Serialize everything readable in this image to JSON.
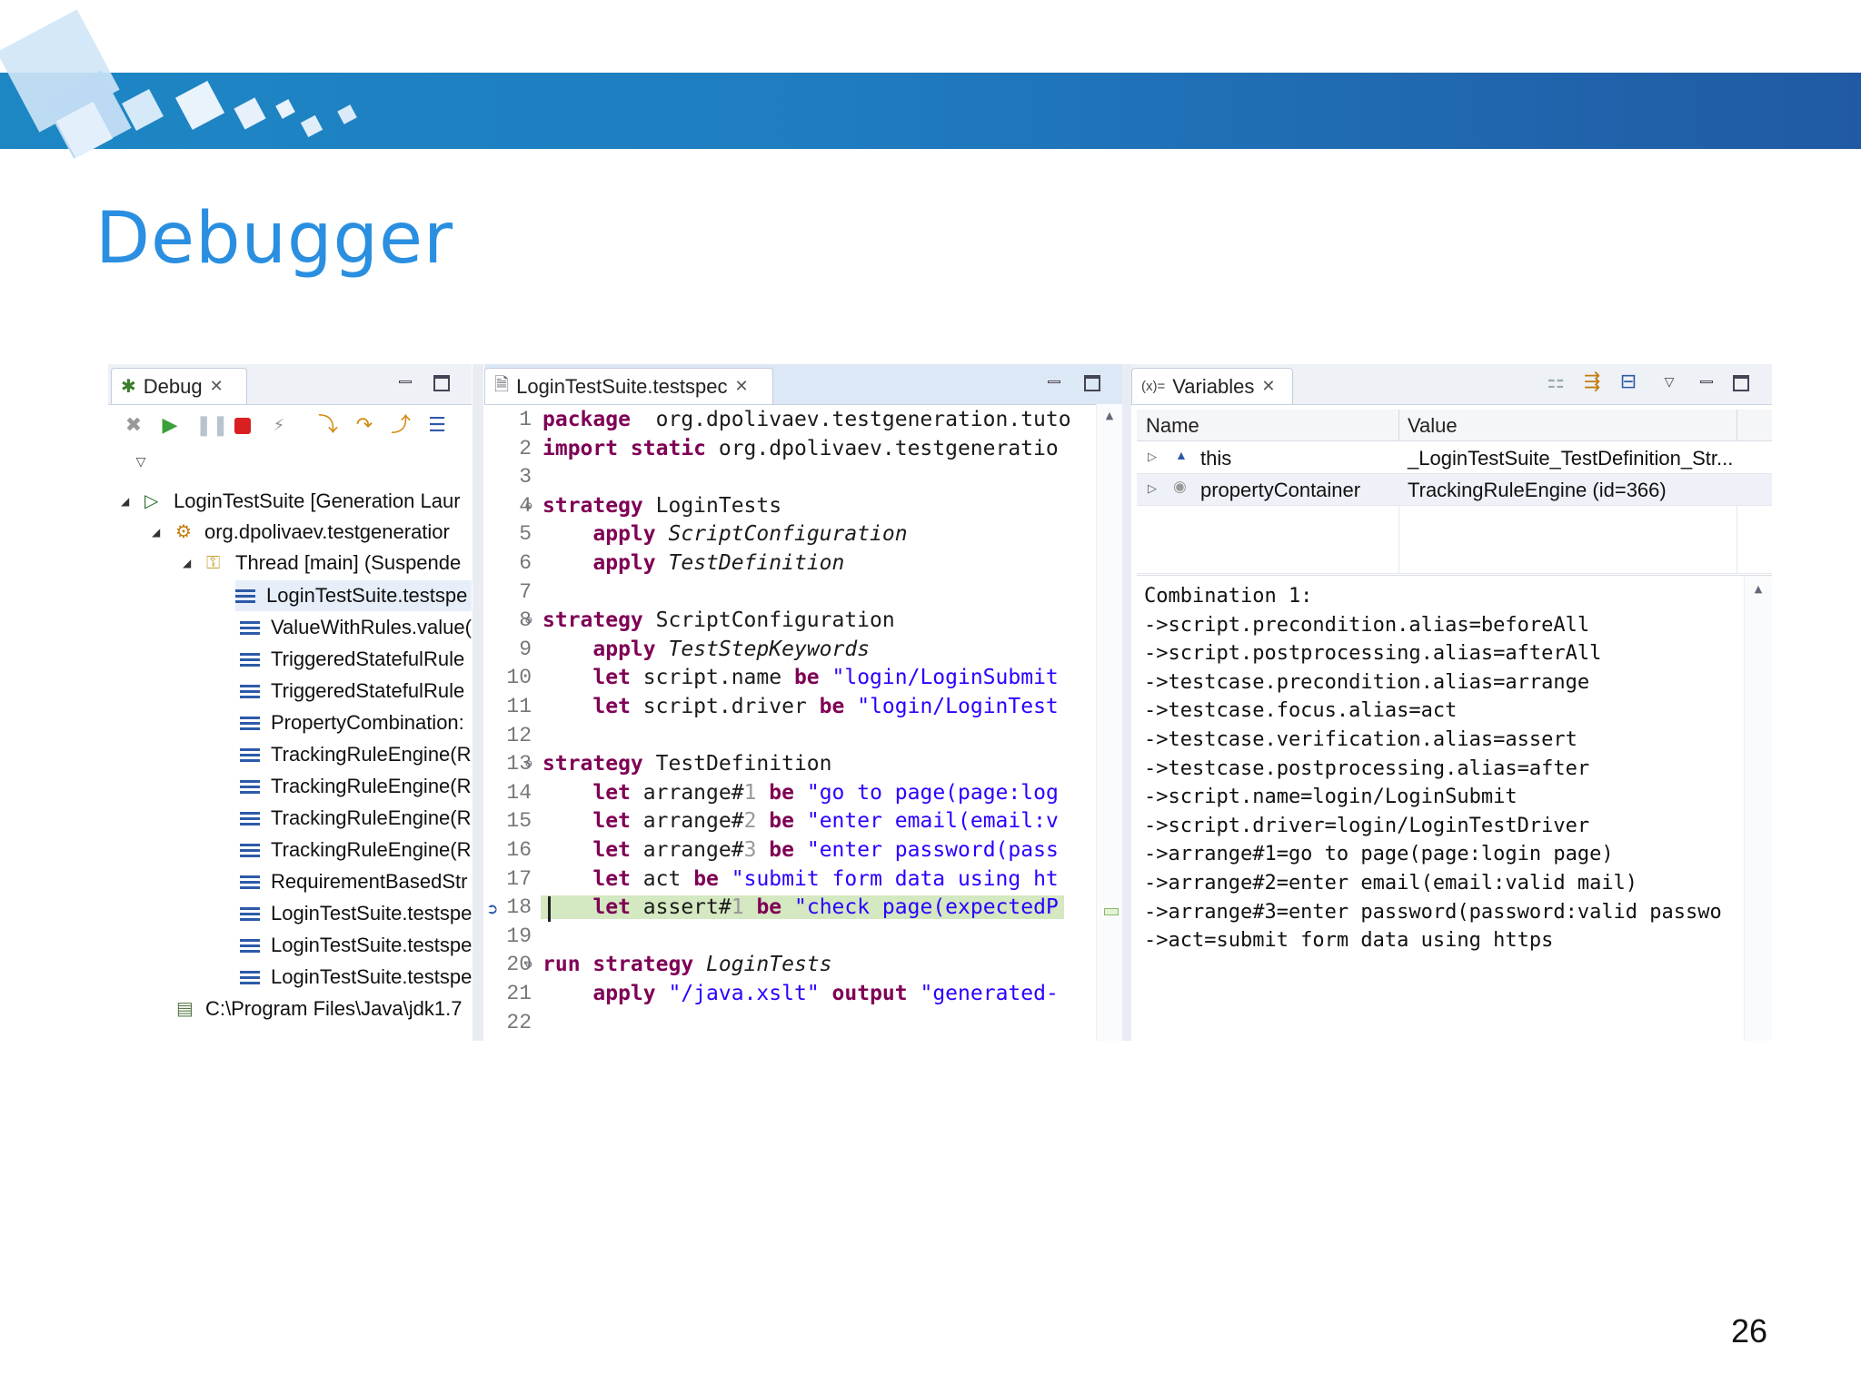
{
  "slide": {
    "title": "Debugger",
    "page_number": "26"
  },
  "colors": {
    "banner": "#1f7cc0",
    "title": "#2a8fe0",
    "keyword": "#7f0055",
    "string": "#2a00ff",
    "current_line": "#d4e8c1"
  },
  "debug_view": {
    "tab_label": "Debug",
    "toolbar_icons": [
      "remove-terminated-icon",
      "resume-icon",
      "suspend-icon",
      "terminate-icon",
      "disconnect-icon",
      "step-into-icon",
      "step-over-icon",
      "step-return-icon",
      "drop-to-frame-icon"
    ],
    "tree": [
      {
        "label": "LoginTestSuite [Generation Laur",
        "icon": "launch-icon",
        "level": 0
      },
      {
        "label": "org.dpolivaev.testgeneratior",
        "icon": "debug-target-icon",
        "level": 1
      },
      {
        "label": "Thread [main] (Suspende",
        "icon": "thread-icon",
        "level": 2
      },
      {
        "label": "LoginTestSuite.testspe",
        "icon": "stack-frame-icon",
        "level": 3,
        "selected": true
      },
      {
        "label": "ValueWithRules.value(",
        "icon": "stack-frame-icon",
        "level": 3
      },
      {
        "label": "TriggeredStatefulRule",
        "icon": "stack-frame-icon",
        "level": 3
      },
      {
        "label": "TriggeredStatefulRule",
        "icon": "stack-frame-icon",
        "level": 3
      },
      {
        "label": "PropertyCombination:",
        "icon": "stack-frame-icon",
        "level": 3
      },
      {
        "label": "TrackingRuleEngine(R",
        "icon": "stack-frame-icon",
        "level": 3
      },
      {
        "label": "TrackingRuleEngine(R",
        "icon": "stack-frame-icon",
        "level": 3
      },
      {
        "label": "TrackingRuleEngine(R",
        "icon": "stack-frame-icon",
        "level": 3
      },
      {
        "label": "TrackingRuleEngine(R",
        "icon": "stack-frame-icon",
        "level": 3
      },
      {
        "label": "RequirementBasedStr",
        "icon": "stack-frame-icon",
        "level": 3
      },
      {
        "label": "LoginTestSuite.testspe",
        "icon": "stack-frame-icon",
        "level": 3
      },
      {
        "label": "LoginTestSuite.testspe",
        "icon": "stack-frame-icon",
        "level": 3
      },
      {
        "label": "LoginTestSuite.testspe",
        "icon": "stack-frame-icon",
        "level": 3
      },
      {
        "label": "C:\\Program Files\\Java\\jdk1.7",
        "icon": "process-icon",
        "level": 1
      }
    ]
  },
  "editor": {
    "tab_label": "LoginTestSuite.testspec",
    "current_line": 18,
    "lines": [
      {
        "n": "1",
        "tokens": [
          [
            "kw",
            "package"
          ],
          [
            "",
            "  org.dpolivaev.testgeneration.tuto"
          ]
        ]
      },
      {
        "n": "2",
        "tokens": [
          [
            "kw",
            "import static"
          ],
          [
            "",
            " org.dpolivaev.testgeneratio"
          ]
        ]
      },
      {
        "n": "3",
        "tokens": []
      },
      {
        "n": "4",
        "fold": true,
        "tokens": [
          [
            "kw",
            "strategy"
          ],
          [
            "",
            " LoginTests"
          ]
        ]
      },
      {
        "n": "5",
        "tokens": [
          [
            "",
            "    "
          ],
          [
            "kw",
            "apply"
          ],
          [
            "",
            " "
          ],
          [
            "it",
            "ScriptConfiguration"
          ]
        ]
      },
      {
        "n": "6",
        "tokens": [
          [
            "",
            "    "
          ],
          [
            "kw",
            "apply"
          ],
          [
            "",
            " "
          ],
          [
            "it",
            "TestDefinition"
          ]
        ]
      },
      {
        "n": "7",
        "tokens": []
      },
      {
        "n": "8",
        "fold": true,
        "tokens": [
          [
            "kw",
            "strategy"
          ],
          [
            "",
            " ScriptConfiguration"
          ]
        ]
      },
      {
        "n": "9",
        "tokens": [
          [
            "",
            "    "
          ],
          [
            "kw",
            "apply"
          ],
          [
            "",
            " "
          ],
          [
            "it",
            "TestStepKeywords"
          ]
        ]
      },
      {
        "n": "10",
        "tokens": [
          [
            "",
            "    "
          ],
          [
            "kw",
            "let"
          ],
          [
            "",
            " script.name "
          ],
          [
            "kw",
            "be"
          ],
          [
            "",
            " "
          ],
          [
            "str",
            "\"login/LoginSubmit"
          ]
        ]
      },
      {
        "n": "11",
        "tokens": [
          [
            "",
            "    "
          ],
          [
            "kw",
            "let"
          ],
          [
            "",
            " script.driver "
          ],
          [
            "kw",
            "be"
          ],
          [
            "",
            " "
          ],
          [
            "str",
            "\"login/LoginTest"
          ]
        ]
      },
      {
        "n": "12",
        "tokens": []
      },
      {
        "n": "13",
        "fold": true,
        "tokens": [
          [
            "kw",
            "strategy"
          ],
          [
            "",
            " TestDefinition"
          ]
        ]
      },
      {
        "n": "14",
        "tokens": [
          [
            "",
            "    "
          ],
          [
            "kw",
            "let"
          ],
          [
            "",
            " arrange#"
          ],
          [
            "dim",
            "1"
          ],
          [
            "",
            " "
          ],
          [
            "kw",
            "be"
          ],
          [
            "",
            " "
          ],
          [
            "str",
            "\"go to page(page:log"
          ]
        ]
      },
      {
        "n": "15",
        "tokens": [
          [
            "",
            "    "
          ],
          [
            "kw",
            "let"
          ],
          [
            "",
            " arrange#"
          ],
          [
            "dim",
            "2"
          ],
          [
            "",
            " "
          ],
          [
            "kw",
            "be"
          ],
          [
            "",
            " "
          ],
          [
            "str",
            "\"enter email(email:v"
          ]
        ]
      },
      {
        "n": "16",
        "tokens": [
          [
            "",
            "    "
          ],
          [
            "kw",
            "let"
          ],
          [
            "",
            " arrange#"
          ],
          [
            "dim",
            "3"
          ],
          [
            "",
            " "
          ],
          [
            "kw",
            "be"
          ],
          [
            "",
            " "
          ],
          [
            "str",
            "\"enter password(pass"
          ]
        ]
      },
      {
        "n": "17",
        "tokens": [
          [
            "",
            "    "
          ],
          [
            "kw",
            "let"
          ],
          [
            "",
            " act "
          ],
          [
            "kw",
            "be"
          ],
          [
            "",
            " "
          ],
          [
            "str",
            "\"submit form data using ht"
          ]
        ]
      },
      {
        "n": "18",
        "tokens": [
          [
            "",
            "    "
          ],
          [
            "kw",
            "let"
          ],
          [
            "",
            " assert#"
          ],
          [
            "dim",
            "1"
          ],
          [
            "",
            " "
          ],
          [
            "kw",
            "be"
          ],
          [
            "",
            " "
          ],
          [
            "str",
            "\"check page(expectedP"
          ]
        ]
      },
      {
        "n": "19",
        "tokens": []
      },
      {
        "n": "20",
        "fold": true,
        "tokens": [
          [
            "kw",
            "run strategy"
          ],
          [
            "",
            " "
          ],
          [
            "it",
            "LoginTests"
          ]
        ]
      },
      {
        "n": "21",
        "tokens": [
          [
            "",
            "    "
          ],
          [
            "kw",
            "apply"
          ],
          [
            "",
            " "
          ],
          [
            "str",
            "\"/java.xslt\""
          ],
          [
            "",
            " "
          ],
          [
            "kw",
            "output"
          ],
          [
            "",
            " "
          ],
          [
            "str",
            "\"generated-"
          ]
        ]
      },
      {
        "n": "22",
        "tokens": []
      }
    ]
  },
  "variables_view": {
    "tab_label": "Variables",
    "tab_icon_text": "(x)=",
    "columns": [
      "Name",
      "Value"
    ],
    "rows": [
      {
        "name": "this",
        "value": "_LoginTestSuite_TestDefinition_Str...",
        "icon": "field-icon"
      },
      {
        "name": "propertyContainer",
        "value": "TrackingRuleEngine  (id=366)",
        "icon": "private-field-icon"
      }
    ],
    "detail_lines": [
      "Combination 1:",
      "->script.precondition.alias=beforeAll",
      "->script.postprocessing.alias=afterAll",
      "->testcase.precondition.alias=arrange",
      "->testcase.focus.alias=act",
      "->testcase.verification.alias=assert",
      "->testcase.postprocessing.alias=after",
      "->script.name=login/LoginSubmit",
      "->script.driver=login/LoginTestDriver",
      "->arrange#1=go to page(page:login page)",
      "->arrange#2=enter email(email:valid mail)",
      "->arrange#3=enter password(password:valid passwo",
      "->act=submit form data using https"
    ]
  }
}
